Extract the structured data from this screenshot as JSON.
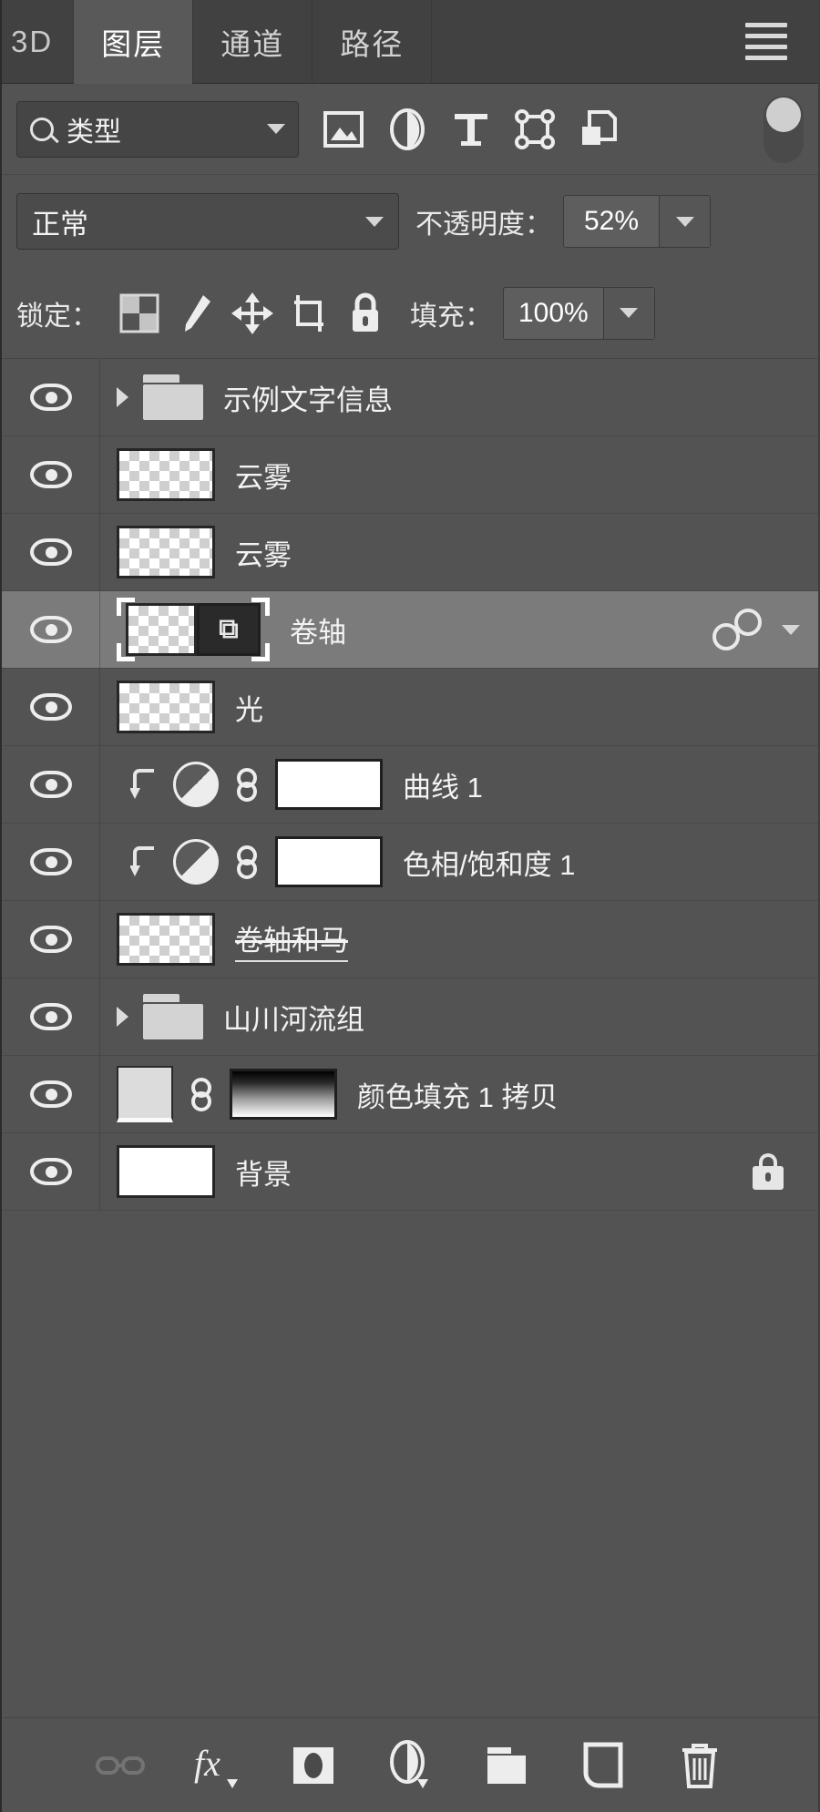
{
  "panel": {
    "tabs": [
      {
        "label": "3D",
        "active": false,
        "partial": true
      },
      {
        "label": "图层",
        "active": true,
        "partial": false
      },
      {
        "label": "通道",
        "active": false,
        "partial": false
      },
      {
        "label": "路径",
        "active": false,
        "partial": false
      }
    ],
    "menu_icon": "hamburger-menu-icon"
  },
  "filter": {
    "search_icon": "search-icon",
    "type_label": "类型",
    "chevron_icon": "chevron-down-icon",
    "icons": [
      {
        "name": "filter-pixel-layers-icon"
      },
      {
        "name": "filter-adjustment-layers-icon"
      },
      {
        "name": "filter-type-layers-icon"
      },
      {
        "name": "filter-shape-layers-icon"
      },
      {
        "name": "filter-smart-object-layers-icon"
      }
    ],
    "toggle_name": "filter-enable-toggle"
  },
  "blend": {
    "mode": "正常",
    "opacity_label": "不透明度：",
    "opacity_value": "52%"
  },
  "lock": {
    "label": "锁定：",
    "icons": [
      {
        "name": "lock-transparent-pixels-icon"
      },
      {
        "name": "lock-image-pixels-icon"
      },
      {
        "name": "lock-position-icon"
      },
      {
        "name": "lock-artboard-nesting-icon"
      },
      {
        "name": "lock-all-icon"
      }
    ],
    "fill_label": "填充：",
    "fill_value": "100%"
  },
  "layers": [
    {
      "name": "示例文字信息",
      "kind": "group",
      "visible": true,
      "selected": false,
      "expanded": false
    },
    {
      "name": "云雾",
      "kind": "pixel",
      "visible": true,
      "selected": false
    },
    {
      "name": "云雾",
      "kind": "pixel",
      "visible": true,
      "selected": false
    },
    {
      "name": "卷轴",
      "kind": "smart-object",
      "visible": true,
      "selected": true,
      "has_effects": true,
      "effects_icon": "smart-filters-icon",
      "expand_icon": "chevron-down-icon"
    },
    {
      "name": "光",
      "kind": "pixel",
      "visible": true,
      "selected": false
    },
    {
      "name": "曲线 1",
      "kind": "adjustment",
      "visible": true,
      "selected": false,
      "clipped": true,
      "mask": "white"
    },
    {
      "name": "色相/饱和度 1",
      "kind": "adjustment",
      "visible": true,
      "selected": false,
      "clipped": true,
      "mask": "white"
    },
    {
      "name": "卷轴和马",
      "kind": "pixel",
      "visible": true,
      "selected": false,
      "renaming": true
    },
    {
      "name": "山川河流组",
      "kind": "group",
      "visible": true,
      "selected": false,
      "expanded": false
    },
    {
      "name": "颜色填充 1 拷贝",
      "kind": "fill",
      "visible": true,
      "selected": false,
      "mask": "gradient"
    },
    {
      "name": "背景",
      "kind": "background",
      "visible": true,
      "selected": false,
      "locked": true,
      "lock_icon": "lock-icon"
    }
  ],
  "bottom_toolbar": [
    {
      "name": "link-layers-icon",
      "dim": true
    },
    {
      "name": "layer-style-fx-icon",
      "dim": false
    },
    {
      "name": "add-layer-mask-icon",
      "dim": false
    },
    {
      "name": "new-adjustment-layer-icon",
      "dim": false
    },
    {
      "name": "new-group-icon",
      "dim": false
    },
    {
      "name": "new-layer-icon",
      "dim": false
    },
    {
      "name": "delete-layer-icon",
      "dim": false
    }
  ]
}
